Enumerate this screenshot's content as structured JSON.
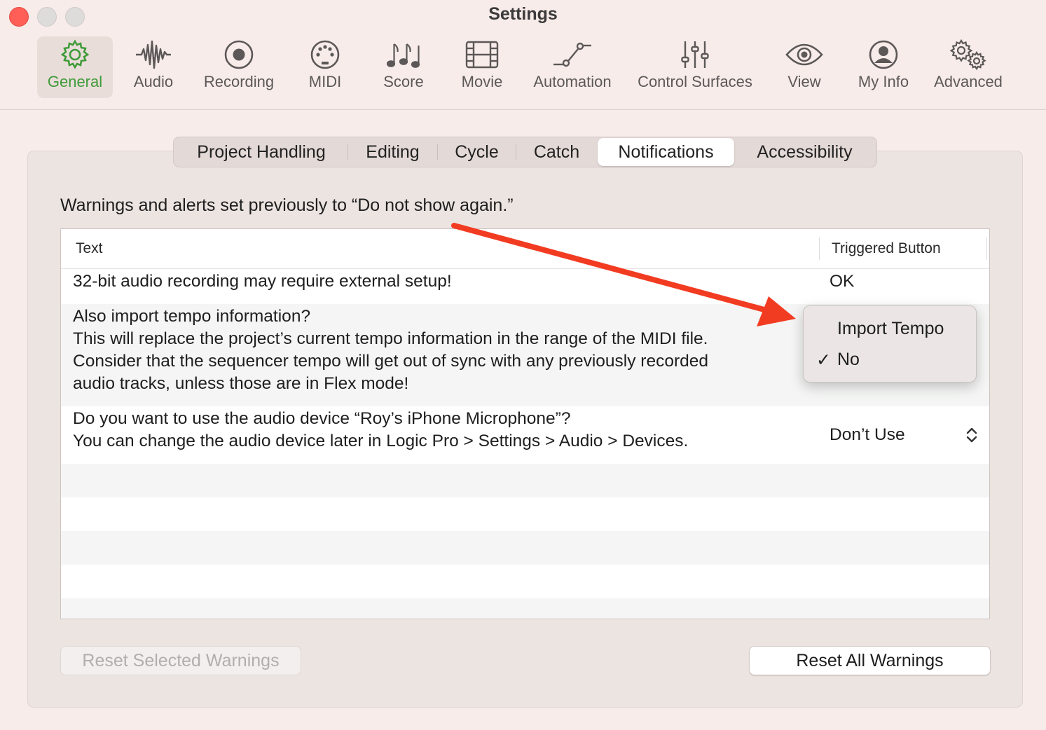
{
  "window": {
    "title": "Settings"
  },
  "colors": {
    "accent_green": "#3f9b3a",
    "annotation_red": "#f23c22",
    "close_red": "#ff5f57"
  },
  "toolbar": {
    "items": [
      {
        "label": "General",
        "icon": "gear-icon",
        "active": true
      },
      {
        "label": "Audio",
        "icon": "waveform-icon",
        "active": false
      },
      {
        "label": "Recording",
        "icon": "record-icon",
        "active": false
      },
      {
        "label": "MIDI",
        "icon": "midi-port-icon",
        "active": false
      },
      {
        "label": "Score",
        "icon": "music-notes-icon",
        "active": false
      },
      {
        "label": "Movie",
        "icon": "film-icon",
        "active": false
      },
      {
        "label": "Automation",
        "icon": "automation-curve-icon",
        "active": false
      },
      {
        "label": "Control Surfaces",
        "icon": "sliders-icon",
        "active": false
      },
      {
        "label": "View",
        "icon": "eye-icon",
        "active": false
      },
      {
        "label": "My Info",
        "icon": "person-icon",
        "active": false
      },
      {
        "label": "Advanced",
        "icon": "gears-icon",
        "active": false
      }
    ]
  },
  "tabs": [
    {
      "label": "Project Handling",
      "selected": false
    },
    {
      "label": "Editing",
      "selected": false
    },
    {
      "label": "Cycle",
      "selected": false
    },
    {
      "label": "Catch",
      "selected": false
    },
    {
      "label": "Notifications",
      "selected": true
    },
    {
      "label": "Accessibility",
      "selected": false
    }
  ],
  "notifications": {
    "description": "Warnings and alerts set previously to “Do not show again.”",
    "columns": {
      "text": "Text",
      "triggered": "Triggered Button"
    },
    "rows": [
      {
        "lines": [
          "32-bit audio recording may require external setup!"
        ],
        "button": "OK"
      },
      {
        "lines": [
          "Also import tempo information?",
          "This will replace the project’s current tempo information in the range of the MIDI file.",
          "Consider that the sequencer tempo will get out of sync with any previously recorded",
          "audio tracks, unless those are in Flex mode!"
        ],
        "button": "No"
      },
      {
        "lines": [
          "Do you want to use the audio device “Roy’s iPhone Microphone”?",
          "You can change the audio device later in Logic Pro > Settings > Audio > Devices."
        ],
        "button": "Don’t Use"
      }
    ],
    "popup": {
      "options": [
        "Import Tempo",
        "No"
      ],
      "selected": "No",
      "checkmark": "✓"
    },
    "buttons": {
      "reset_selected": "Reset Selected Warnings",
      "reset_all": "Reset All Warnings"
    }
  }
}
